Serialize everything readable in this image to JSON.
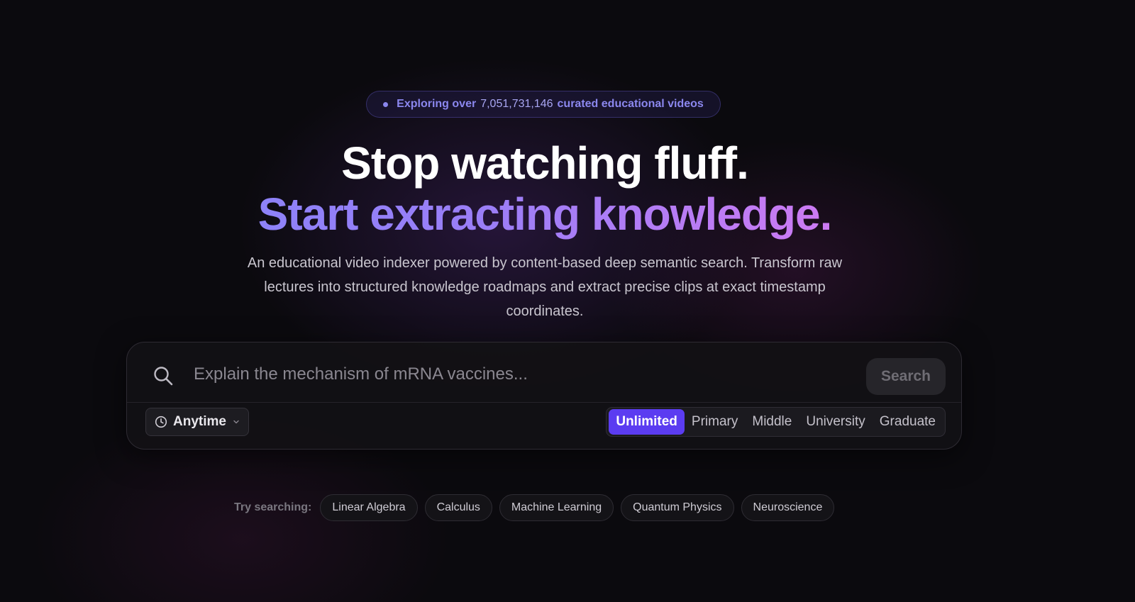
{
  "badge": {
    "prefix": "Exploring over",
    "count": "7,051,731,146",
    "suffix": "curated educational videos"
  },
  "hero": {
    "headline_line1": "Stop watching fluff.",
    "headline_line2": "Start extracting knowledge.",
    "subtitle": "An educational video indexer powered by content-based deep semantic search. Transform raw lectures into structured knowledge roadmaps and extract precise clips at exact timestamp coordinates."
  },
  "search": {
    "placeholder": "Explain the mechanism of mRNA vaccines...",
    "value": "",
    "button_label": "Search",
    "icon": "search-icon"
  },
  "filters": {
    "time": {
      "label": "Anytime",
      "icon": "clock-icon"
    },
    "levels": [
      {
        "label": "Unlimited",
        "active": true
      },
      {
        "label": "Primary",
        "active": false
      },
      {
        "label": "Middle",
        "active": false
      },
      {
        "label": "University",
        "active": false
      },
      {
        "label": "Graduate",
        "active": false
      }
    ]
  },
  "suggestions": {
    "label": "Try searching:",
    "items": [
      "Linear Algebra",
      "Calculus",
      "Machine Learning",
      "Quantum Physics",
      "Neuroscience"
    ]
  },
  "colors": {
    "accent": "#5b3cf1",
    "badge_text": "#8b87ee",
    "gradient_start": "#7f86fa",
    "gradient_end": "#e57ef0"
  }
}
